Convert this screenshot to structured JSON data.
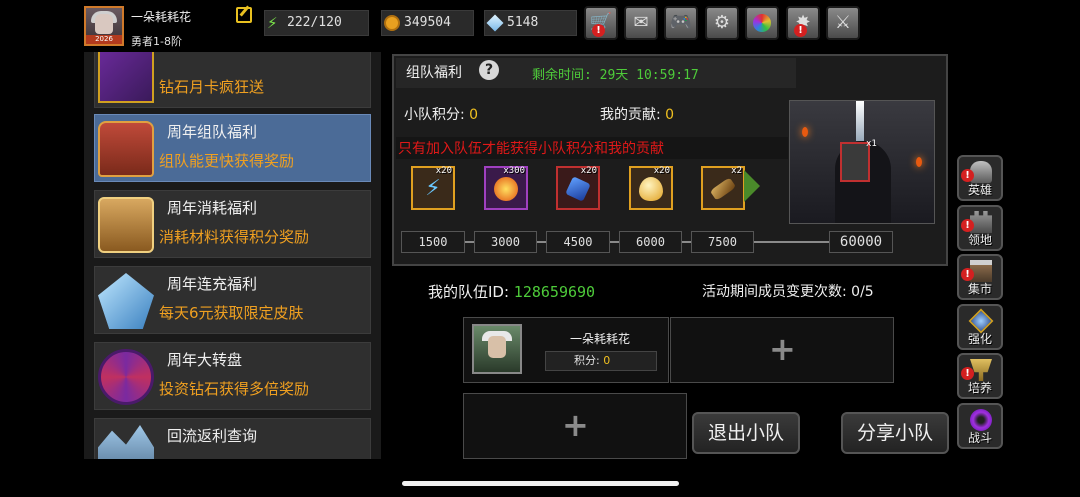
{
  "player": {
    "name": "一朵耗耗花",
    "rank": "勇者1-8阶",
    "avatar_year": "2026"
  },
  "resources": {
    "energy": "222/120",
    "gold": "349504",
    "gems": "5148"
  },
  "toolbar": {
    "icons": [
      "cart-icon",
      "mail-icon",
      "gamepad-icon",
      "gear-icon",
      "color-wheel-icon",
      "fireworks-icon",
      "swords-icon"
    ]
  },
  "events": [
    {
      "title": "",
      "subtitle": "钻石月卡疯狂送"
    },
    {
      "title": "周年组队福利",
      "subtitle": "组队能更快获得奖励"
    },
    {
      "title": "周年消耗福利",
      "subtitle": "消耗材料获得积分奖励"
    },
    {
      "title": "周年连充福利",
      "subtitle": "每天6元获取限定皮肤"
    },
    {
      "title": "周年大转盘",
      "subtitle": "投资钻石获得多倍奖励"
    },
    {
      "title": "回流返利查询",
      "subtitle": ""
    }
  ],
  "panel": {
    "title": "组队福利",
    "help": "?",
    "time_remaining": "剩余时间: 29天 10:59:17",
    "team_score_label": "小队积分: ",
    "team_score_value": "0",
    "my_contrib_label": "我的贡献: ",
    "my_contrib_value": "0",
    "warning": "只有加入队伍才能获得小队积分和我的贡献"
  },
  "rewards": [
    {
      "count": "x20",
      "icon": "lightning-icon",
      "color": "#e0a020"
    },
    {
      "count": "x300",
      "icon": "fire-orb-icon",
      "color": "#a040c0"
    },
    {
      "count": "x20",
      "icon": "blue-gem-icon",
      "color": "#c03030"
    },
    {
      "count": "x20",
      "icon": "golden-egg-icon",
      "color": "#e0a020"
    },
    {
      "count": "x2",
      "icon": "scroll-icon",
      "color": "#e0a020"
    }
  ],
  "milestones": [
    "1500",
    "3000",
    "4500",
    "6000",
    "7500"
  ],
  "final_milestone": "60000",
  "dungeon_reward": {
    "count": "x1",
    "icon": "dagger-icon"
  },
  "team": {
    "id_label": "我的队伍ID: ",
    "id_value": "128659690",
    "change_label": "活动期间成员变更次数: 0/5",
    "member_name": "一朵耗耗花",
    "member_score": "积分: ",
    "member_score_value": "0",
    "plus": "+"
  },
  "buttons": {
    "leave": "退出小队",
    "share": "分享小队"
  },
  "side_nav": [
    {
      "label": "英雄",
      "icon": "hero-helmet-icon",
      "alert": true
    },
    {
      "label": "领地",
      "icon": "castle-icon",
      "alert": true
    },
    {
      "label": "集市",
      "icon": "market-icon",
      "alert": true
    },
    {
      "label": "强化",
      "icon": "upgrade-gem-icon",
      "alert": false
    },
    {
      "label": "培养",
      "icon": "trophy-icon",
      "alert": true
    },
    {
      "label": "战斗",
      "icon": "portal-icon",
      "alert": false
    }
  ]
}
